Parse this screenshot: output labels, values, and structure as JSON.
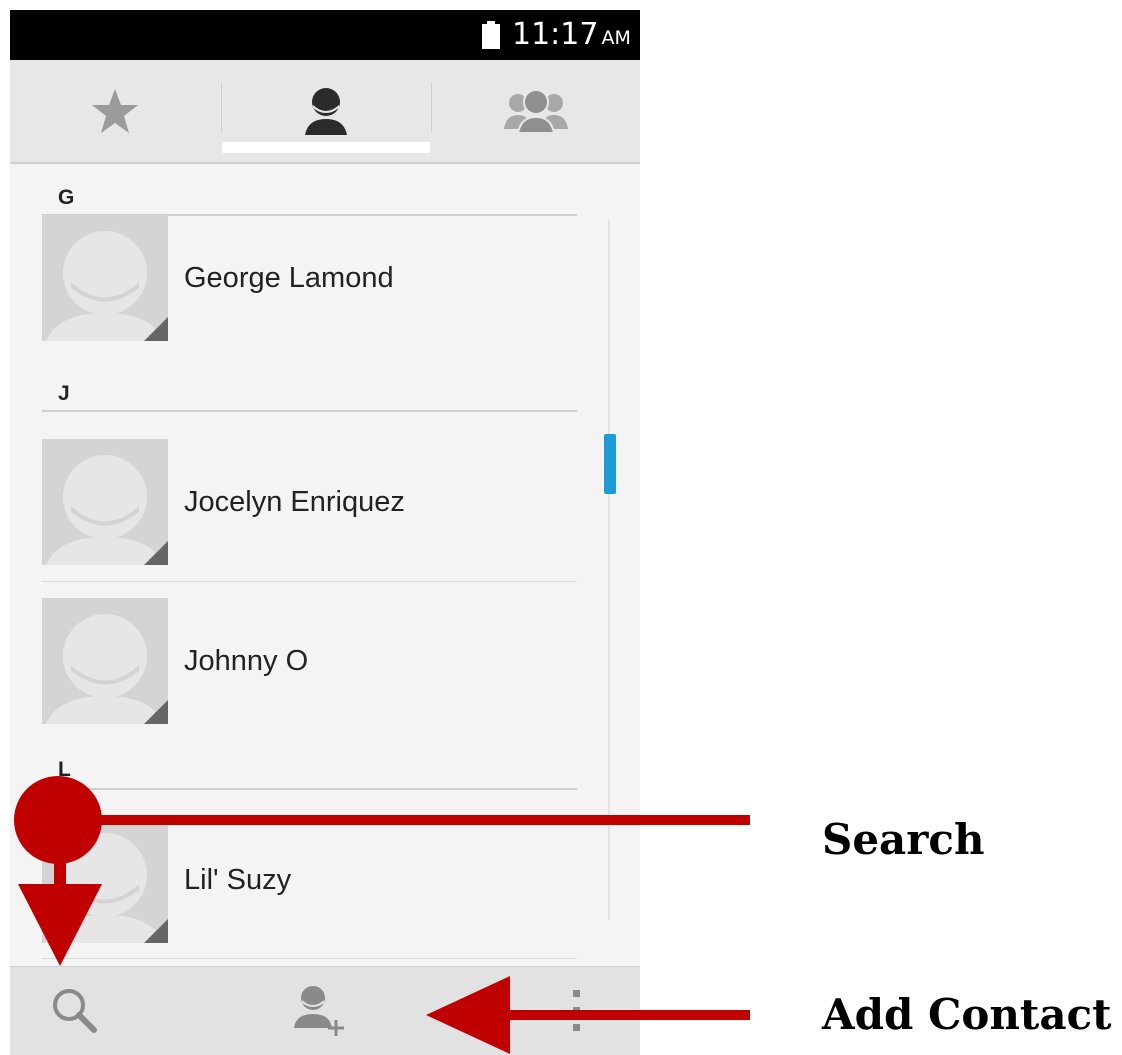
{
  "status_bar": {
    "time": "11:17",
    "ampm": "AM"
  },
  "tabs": [
    {
      "icon": "star-icon",
      "label": "Favorites"
    },
    {
      "icon": "person-icon",
      "label": "Contacts",
      "selected": true
    },
    {
      "icon": "group-icon",
      "label": "Groups"
    }
  ],
  "contacts_list": {
    "sections": [
      {
        "letter": "G",
        "contacts": [
          {
            "name": "George Lamond"
          }
        ]
      },
      {
        "letter": "J",
        "contacts": [
          {
            "name": "Jocelyn Enriquez"
          },
          {
            "name": "Johnny O"
          }
        ]
      },
      {
        "letter": "L",
        "contacts": [
          {
            "name": "Lil' Suzy"
          }
        ]
      }
    ]
  },
  "bottom_bar": {
    "search_icon": "search-icon",
    "add_contact_icon": "add-contact-icon",
    "overflow_icon": "overflow-menu-icon"
  },
  "annotations": {
    "search_label": "Search",
    "add_contact_label": "Add Contact"
  },
  "colors": {
    "accent": "#1e9bd7",
    "annotation": "#c00000"
  }
}
